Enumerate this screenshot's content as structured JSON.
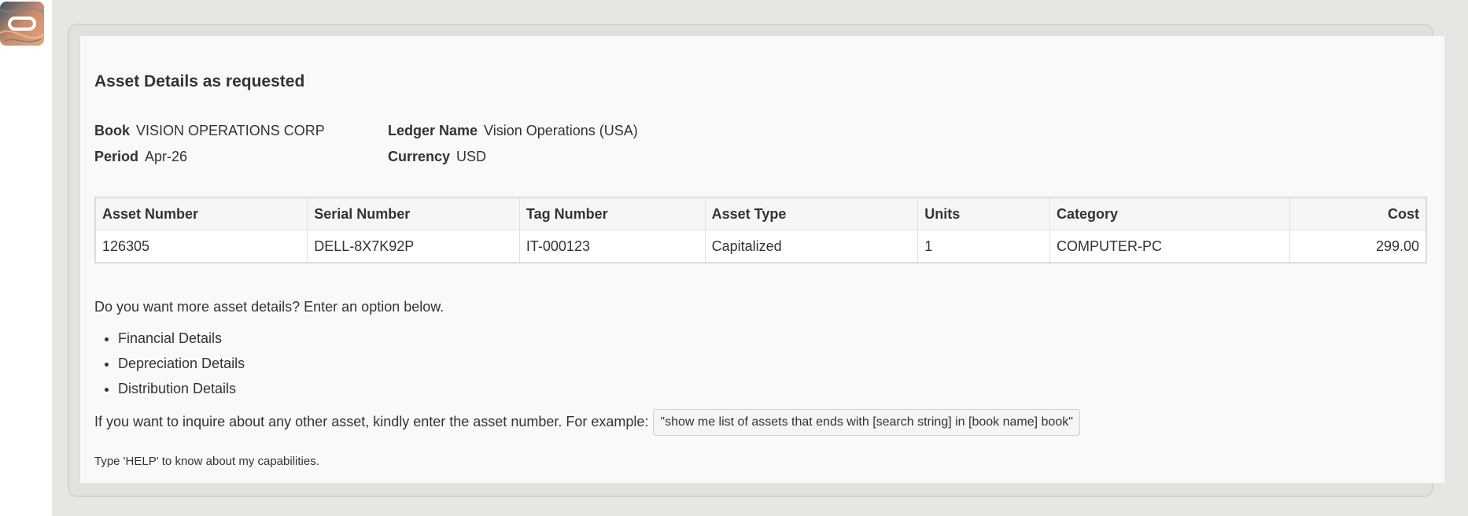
{
  "message": {
    "title": "Asset Details as requested",
    "book_label": "Book",
    "book_value": "VISION OPERATIONS CORP",
    "period_label": "Period",
    "period_value": "Apr-26",
    "ledger_label": "Ledger Name",
    "ledger_value": "Vision Operations (USA)",
    "currency_label": "Currency",
    "currency_value": "USD",
    "table": {
      "headers": [
        "Asset Number",
        "Serial Number",
        "Tag Number",
        "Asset Type",
        "Units",
        "Category",
        "Cost"
      ],
      "rows": [
        [
          "126305",
          "DELL-8X7K92P",
          "IT-000123",
          "Capitalized",
          "1",
          "COMPUTER-PC",
          "299.00"
        ]
      ]
    },
    "more_prompt": "Do you want more asset details? Enter an option below.",
    "options": [
      "Financial Details",
      "Depreciation Details",
      "Distribution Details"
    ],
    "inquire_text": "If you want to inquire about any other asset, kindly enter the asset number. For example:",
    "example_chip": "\"show me list of assets that ends with [search string] in [book name] book\"",
    "help_text": "Type 'HELP' to know about my capabilities."
  },
  "colors": {
    "stage_bg": "#e8e6e3",
    "bubble_bg": "#f8f9fb",
    "avatar_accent": "#e0956b"
  },
  "icons": {
    "avatar": "oracle-bot-avatar-icon"
  }
}
